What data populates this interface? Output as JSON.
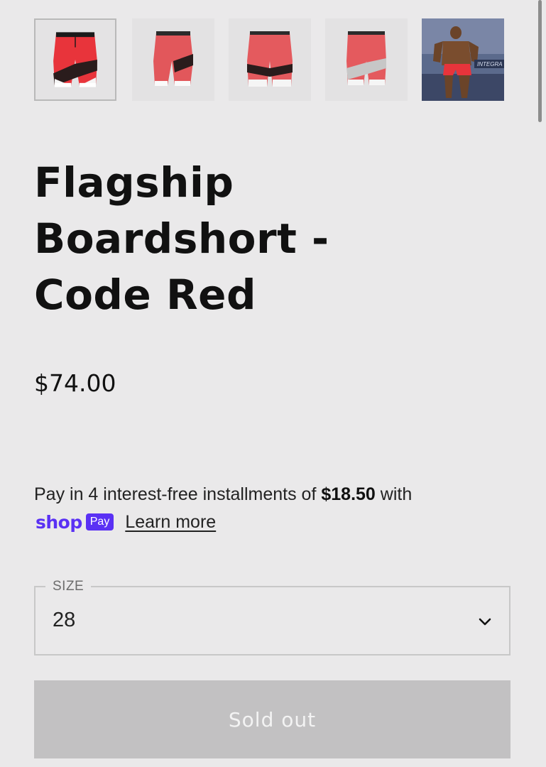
{
  "gallery": {
    "thumbnails": [
      {
        "alt": "Front view",
        "selected": true
      },
      {
        "alt": "Side view",
        "selected": false
      },
      {
        "alt": "Back view",
        "selected": false
      },
      {
        "alt": "Three-quarter view",
        "selected": false
      },
      {
        "alt": "Athlete wearing shorts",
        "selected": false
      }
    ],
    "photo_overlay_text": "INTEGRA"
  },
  "product": {
    "title_line1": "Flagship",
    "title_line2": "Boardshort -",
    "title_line3": "Code Red",
    "price": "$74.00"
  },
  "payment": {
    "prefix": "Pay in 4 interest-free installments of ",
    "amount": "$18.50",
    "suffix": " with",
    "shop_word": "shop",
    "pay_badge": "Pay",
    "learn_more": "Learn more"
  },
  "variant": {
    "label": "SIZE",
    "value": "28",
    "icon": "chevron-down-icon"
  },
  "cta": {
    "label": "Sold out",
    "disabled": true
  },
  "colors": {
    "background": "#eae9ea",
    "shop_pay_purple": "#5a31f4",
    "disabled_button": "#c2c1c2",
    "shorts_red": "#e8343b"
  }
}
